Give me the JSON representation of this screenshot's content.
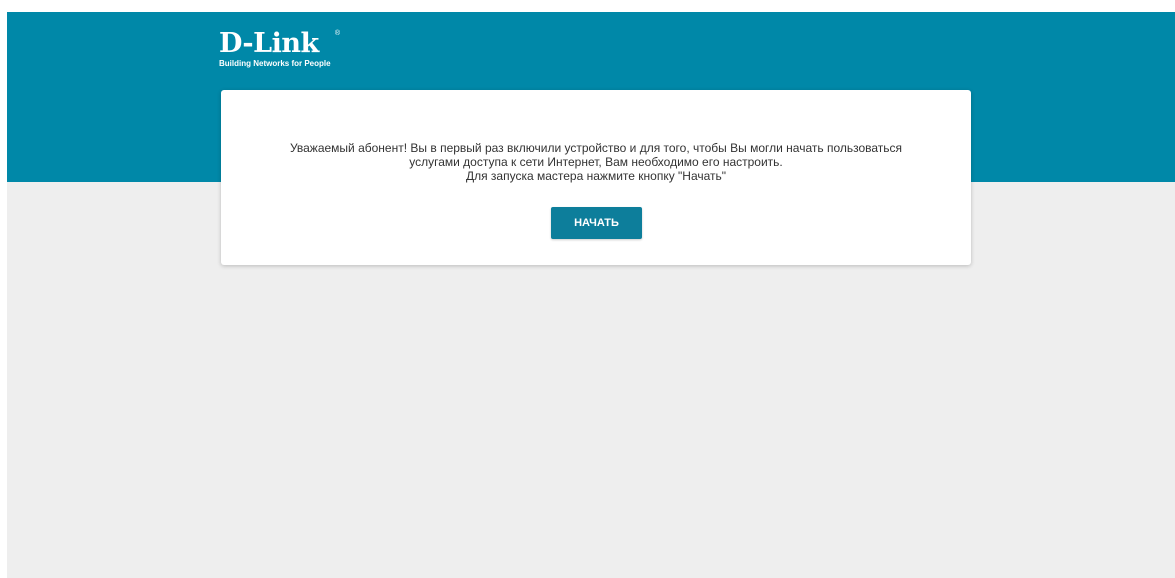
{
  "brand": {
    "logo_text": "D-Link",
    "registered_mark": "®",
    "tagline": "Building Networks for People"
  },
  "welcome": {
    "line1": "Уважаемый абонент! Вы в первый раз включили устройство и для того, чтобы Вы могли начать пользоваться",
    "line2": "услугами доступа к сети Интернет, Вам необходимо его настроить.",
    "line3": "Для запуска мастера нажмите кнопку \"Начать\"",
    "start_button_label": "НАЧАТЬ"
  },
  "colors": {
    "header_background": "#0088a8",
    "page_background": "#eeeeee",
    "button_background": "#0d7e9b"
  }
}
